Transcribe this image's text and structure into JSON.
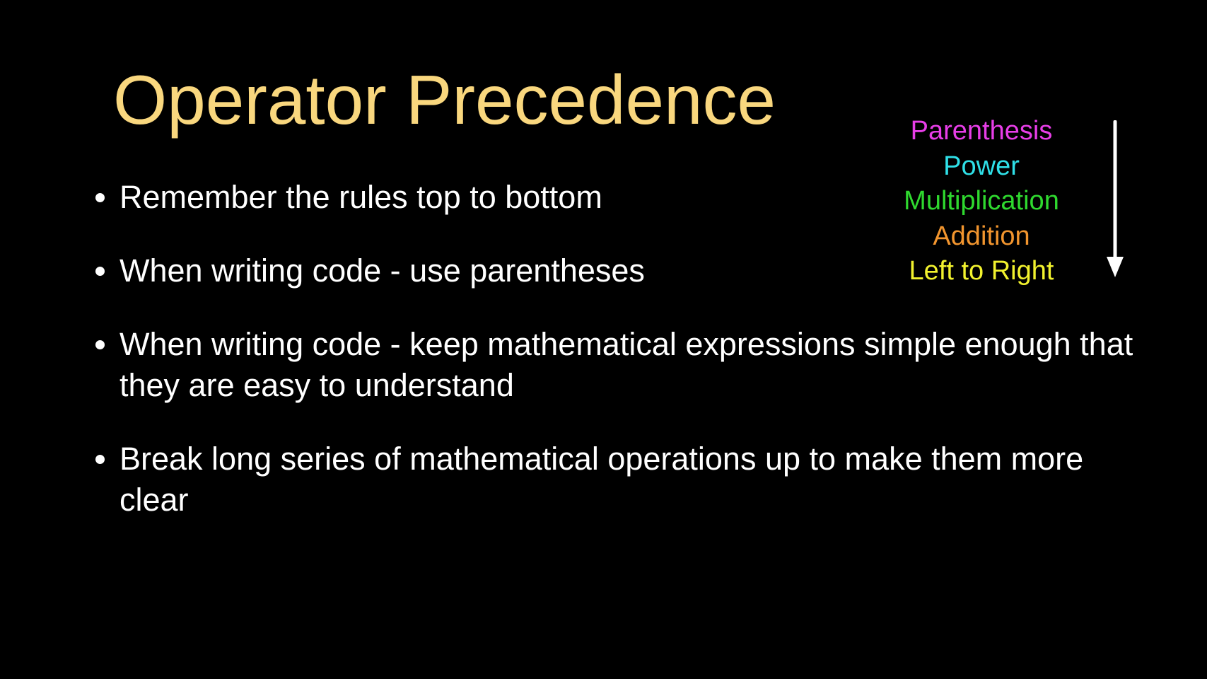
{
  "slide": {
    "title": "Operator Precedence",
    "title_color": "#f9d77e",
    "bullets": [
      "Remember the rules top to bottom",
      "When writing code - use parentheses",
      "When writing code - keep mathematical expressions simple enough that they are easy to understand",
      "Break long series of mathematical operations up to make them more clear"
    ],
    "precedence": [
      {
        "label": "Parenthesis",
        "color": "#e83ee8"
      },
      {
        "label": "Power",
        "color": "#2fe0e8"
      },
      {
        "label": "Multiplication",
        "color": "#2fd92f"
      },
      {
        "label": "Addition",
        "color": "#f2952e"
      },
      {
        "label": "Left to Right",
        "color": "#f2f22e"
      }
    ],
    "arrow_icon": "arrow-down-icon"
  }
}
